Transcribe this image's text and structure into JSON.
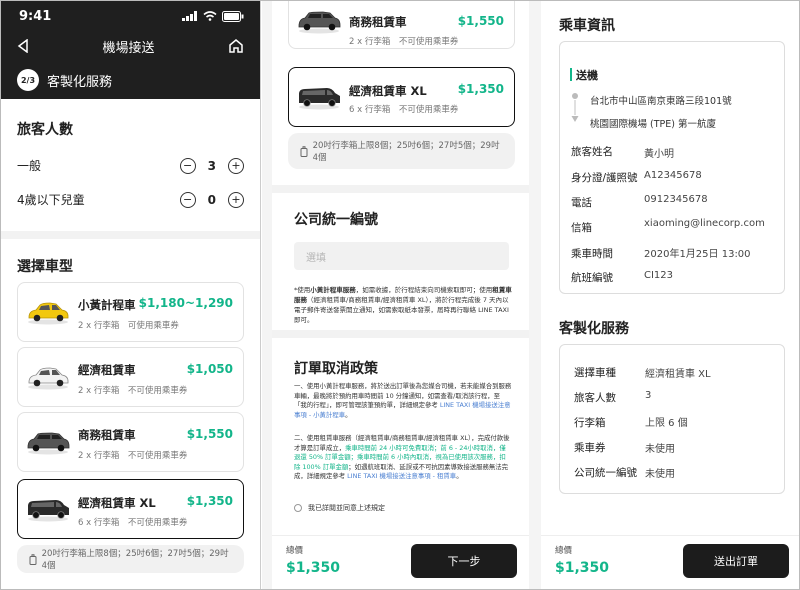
{
  "left": {
    "status_time": "9:41",
    "nav_title": "機場接送",
    "step": "2/3",
    "step_title": "客製化服務",
    "passengers_title": "旅客人數",
    "passengers": [
      {
        "label": "一般",
        "minus": "−",
        "value": "3",
        "plus": "+"
      },
      {
        "label": "4歲以下兒童",
        "minus": "−",
        "value": "0",
        "plus": "+"
      }
    ],
    "vehicle_title": "選擇車型",
    "cars": [
      {
        "name": "小黃計程車",
        "price": "$1,180~1,290",
        "meta": "2 x 行李箱　可使用乘車券",
        "color": "#f2c80f"
      },
      {
        "name": "經濟租賃車",
        "price": "$1,050",
        "meta": "2 x 行李箱　不可使用乘車券",
        "color": "#f3f3f3"
      },
      {
        "name": "商務租賃車",
        "price": "$1,550",
        "meta": "2 x 行李箱　不可使用乘車券",
        "color": "#555555"
      },
      {
        "name": "經濟租賃車 XL",
        "price": "$1,350",
        "meta": "6 x 行李箱　不可使用乘車券",
        "color": "#2a2a2a"
      }
    ],
    "luggage_note": "20吋行李箱上限8個；25吋6個；27吋5個；29吋4個"
  },
  "middle": {
    "car_top": {
      "name": "商務租賃車",
      "price": "$1,550",
      "meta": "2 x 行李箱　不可使用乘車券"
    },
    "car_sel": {
      "name": "經濟租賃車 XL",
      "price": "$1,350",
      "meta": "6 x 行李箱　不可使用乘車券"
    },
    "luggage_note": "20吋行李箱上限8個；25吋6個；27吋5個；29吋4個",
    "tax_title": "公司統一編號",
    "tax_placeholder": "選填",
    "tax_note_a": "*使用",
    "tax_note_b": "小黃計程車服務",
    "tax_note_c": "，如需收據，於行程結束向司機索取即可；使用",
    "tax_note_d": "租賃車服務",
    "tax_note_e": "（經濟租賃車/商務租賃車/經濟租賃車 XL），將於行程完成後 7 天內以電子郵件寄送發票開立通知，如需索取紙本發票，屆時再行聯絡 LINE TAXI 即可。",
    "cancel_title": "訂單取消政策",
    "cancel_p1": "一、使用小黃計程車服務，將於送出訂單後為您媒合司機，若未能媒合到服務車輛，最晚將於預約用車時間前 10 分鐘通知，如需查看/取消該行程，至「我的行程」，即可管理該筆預約單，詳細規定參考 ",
    "cancel_p1_link": "LINE TAXI 機場接送注意事項 - 小黃計程車",
    "cancel_p1_end": "。",
    "cancel_p2a": "二、使用租賃車服務（經濟租賃車/商務租賃車/經濟租賃車 XL），完成付款後才算是訂單成立，",
    "cancel_p2b": "乘車時間前 24 小時可免費取消；前 6 - 24小時取消，僅退還 50% 訂單金額；乘車時間前 6 小時內取消，視為已使用該次服務，扣除 100% 訂單金額",
    "cancel_p2c": "；如遇航班取消、延誤或不可抗因素導致接送服務無法完成，詳細規定參考 ",
    "cancel_p2_link": "LINE TAXI 機場接送注意事項 - 租賃車",
    "cancel_p2_end": "。",
    "agree": "我已詳閱並同意上述規定",
    "total_label": "總價",
    "total": "$1,350",
    "next": "下一步"
  },
  "right": {
    "title": "乘車資訊",
    "section": "送機",
    "from": "台北市中山區南京東路三段101號",
    "to": "桃園國際機場 (TPE) 第一航廈",
    "rows": [
      {
        "label": "旅客姓名",
        "value": "黃小明"
      },
      {
        "label": "身分證/護照號",
        "value": "A12345678"
      },
      {
        "label": "電話",
        "value": "0912345678"
      },
      {
        "label": "信箱",
        "value": "xiaoming@linecorp.com"
      },
      {
        "label": "乘車時間",
        "value": "2020年1月25日 13:00"
      },
      {
        "label": "航班編號",
        "value": "CI123"
      }
    ],
    "custom_title": "客製化服務",
    "custom_rows": [
      {
        "label": "選擇車種",
        "value": "經濟租賃車 XL"
      },
      {
        "label": "旅客人數",
        "value": "3"
      },
      {
        "label": "行李箱",
        "value": "上限 6 個"
      },
      {
        "label": "乘車券",
        "value": "未使用"
      },
      {
        "label": "公司統一編號",
        "value": "未使用"
      }
    ],
    "total_label": "總價",
    "total": "$1,350",
    "submit": "送出訂單"
  },
  "accent_color": "#13b58a"
}
